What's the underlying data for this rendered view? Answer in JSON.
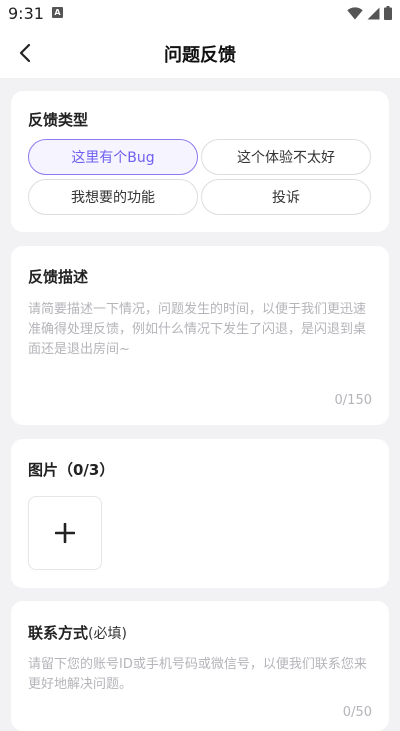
{
  "status_bar": {
    "time": "9:31",
    "notification_icon": "A",
    "icons": [
      "wifi-icon",
      "signal-icon",
      "battery-icon"
    ]
  },
  "header": {
    "title": "问题反馈",
    "back_icon": "chevron-left-icon"
  },
  "feedback_type": {
    "title": "反馈类型",
    "options": [
      {
        "label": "这里有个Bug",
        "selected": true
      },
      {
        "label": "这个体验不太好",
        "selected": false
      },
      {
        "label": "我想要的功能",
        "selected": false
      },
      {
        "label": "投诉",
        "selected": false
      }
    ]
  },
  "description": {
    "title": "反馈描述",
    "placeholder": "请简要描述一下情况，问题发生的时间，以便于我们更迅速准确得处理反馈，例如什么情况下发生了闪退，是闪退到桌面还是退出房间~",
    "counter": "0/150"
  },
  "images": {
    "title": "图片（0/3）",
    "add_icon": "plus-icon"
  },
  "contact": {
    "title": "联系方式",
    "required_note": "(必填)",
    "placeholder": "请留下您的账号ID或手机号码或微信号，以便我们联系您来更好地解决问题。",
    "counter": "0/50"
  },
  "colors": {
    "accent": "#6f5ff0",
    "accent_border": "#8a7cf0",
    "background": "#f2f2f4",
    "placeholder": "#b4b4ba"
  }
}
